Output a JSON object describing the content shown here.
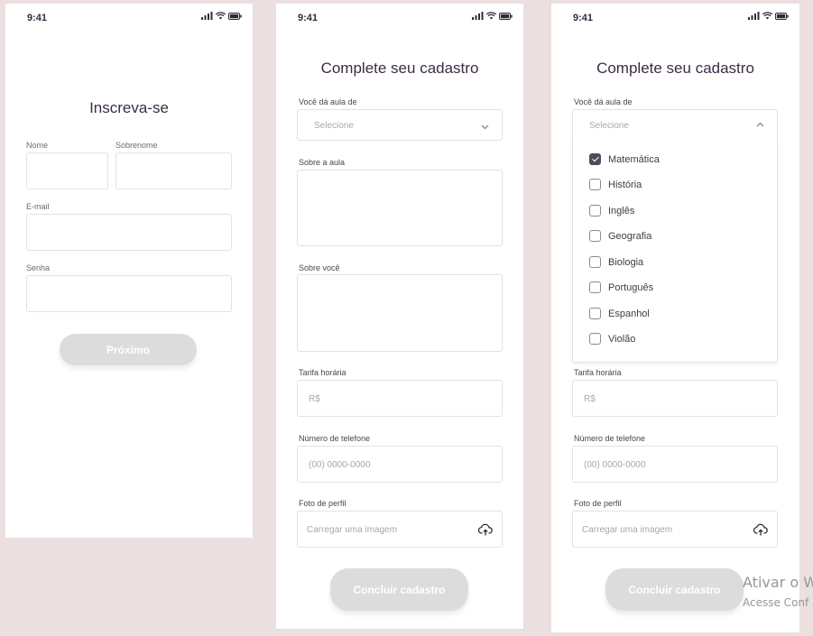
{
  "screens": {
    "signup": {
      "time": "9:41",
      "title": "Inscreva-se",
      "first_name_label": "Nome",
      "last_name_label": "Sobrenome",
      "email_label": "E-mail",
      "password_label": "Senha",
      "next_button": "Próximo"
    },
    "profile": {
      "time": "9:41",
      "title": "Complete seu cadastro",
      "subject_label": "Você dá aula de",
      "subject_placeholder": "Selecione",
      "about_class_label": "Sobre a aula",
      "about_you_label": "Sobre você",
      "rate_label": "Tarifa horária",
      "rate_placeholder": "R$",
      "phone_label": "Número de telefone",
      "phone_placeholder": "(00) 0000-0000",
      "photo_label": "Foto de perfil",
      "photo_placeholder": "Carregar uma imagem",
      "submit_button": "Concluir cadastro"
    },
    "profile_dropdown": {
      "time": "9:41",
      "title": "Complete seu cadastro",
      "subject_label": "Você dá aula de",
      "subject_placeholder": "Selecione",
      "options": [
        {
          "label": "Matemática",
          "checked": true
        },
        {
          "label": "História",
          "checked": false
        },
        {
          "label": "Inglês",
          "checked": false
        },
        {
          "label": "Geografia",
          "checked": false
        },
        {
          "label": "Biologia",
          "checked": false
        },
        {
          "label": "Português",
          "checked": false
        },
        {
          "label": "Espanhol",
          "checked": false
        },
        {
          "label": "Violão",
          "checked": false
        }
      ],
      "rate_label": "Tarifa horária",
      "rate_placeholder": "R$",
      "phone_label": "Número de telefone",
      "phone_placeholder": "(00) 0000-0000",
      "photo_label": "Foto de perfil",
      "photo_placeholder": "Carregar uma imagem",
      "submit_button": "Concluir cadastro"
    }
  },
  "watermark": {
    "line1": "Ativar o W",
    "line2": "Acesse Conf"
  },
  "colors": {
    "background": "#ecdfe0",
    "title": "#3d2b45",
    "button_disabled": "#dcdcdc",
    "checkbox_checked": "#4f4c59"
  }
}
